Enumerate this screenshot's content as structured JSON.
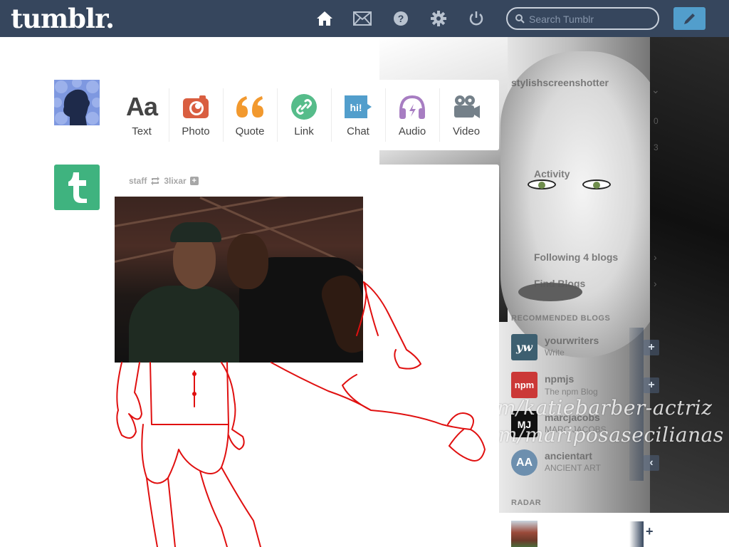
{
  "header": {
    "logo": "tumblr.",
    "nav": [
      {
        "name": "home-icon"
      },
      {
        "name": "mail-icon"
      },
      {
        "name": "help-icon"
      },
      {
        "name": "gear-icon"
      },
      {
        "name": "power-icon"
      }
    ],
    "search_placeholder": "Search Tumblr",
    "compose_icon": "pencil-icon"
  },
  "post_types": [
    {
      "label": "Text",
      "icon": "text-icon",
      "color": "#444444"
    },
    {
      "label": "Photo",
      "icon": "camera-icon",
      "color": "#d95e40"
    },
    {
      "label": "Quote",
      "icon": "quote-icon",
      "color": "#f2992e"
    },
    {
      "label": "Link",
      "icon": "link-icon",
      "color": "#56bc8a"
    },
    {
      "label": "Chat",
      "icon": "chat-icon",
      "color": "#529ecc"
    },
    {
      "label": "Audio",
      "icon": "headphones-icon",
      "color": "#a77dc2"
    },
    {
      "label": "Video",
      "icon": "video-camera-icon",
      "color": "#748089"
    }
  ],
  "post": {
    "author": "staff",
    "reblog_source": "3lixar",
    "reblog_icon": "reblog-icon",
    "expand_icon": "plus-box-icon"
  },
  "sidebar": {
    "blog_name": "stylishscreenshotter",
    "posts_count": "0",
    "followers_count": "3",
    "activity_label": "Activity",
    "following_label": "Following 4 blogs",
    "find_blogs_label": "Find Blogs",
    "recommended_heading": "RECOMMENDED BLOGS",
    "recommended": [
      {
        "name": "yourwriters",
        "subtitle": "Write",
        "initials": "yw",
        "color": "#3d5f70"
      },
      {
        "name": "npmjs",
        "subtitle": "The npm Blog",
        "initials": "npm",
        "color": "#cb3837"
      },
      {
        "name": "marcjacobs",
        "subtitle": "MARC JACOBS",
        "initials": "MJ",
        "color": "#111111"
      },
      {
        "name": "ancientart",
        "subtitle": "ANCIENT ART",
        "initials": "AA",
        "color": "#6d8fae"
      }
    ],
    "radar_heading": "RADAR",
    "watermark_1": "m/katiebarber-actriz",
    "watermark_2": "m/mariposasecilianas"
  }
}
